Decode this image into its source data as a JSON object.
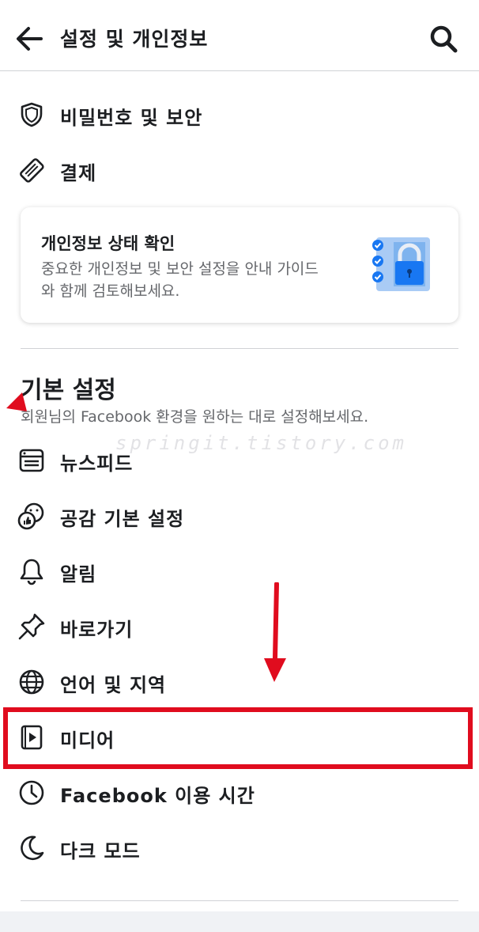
{
  "header": {
    "title": "설정 및 개인정보",
    "back_icon": "arrow-left-icon",
    "search_icon": "search-icon"
  },
  "top_items": [
    {
      "label": "비밀번호 및 보안",
      "icon": "shield-icon"
    },
    {
      "label": "결제",
      "icon": "payment-card-icon"
    }
  ],
  "privacy_card": {
    "title": "개인정보 상태 확인",
    "description": "중요한 개인정보 및 보안 설정을 안내 가이드와 함께 검토해보세요.",
    "art": "privacy-lock-illustration-icon"
  },
  "basic_settings": {
    "title": "기본 설정",
    "subtitle": "회원님의 Facebook 환경을 원하는 대로 설정해보세요.",
    "items": [
      {
        "label": "뉴스피드",
        "icon": "news-feed-icon"
      },
      {
        "label": "공감 기본 설정",
        "icon": "reactions-icon"
      },
      {
        "label": "알림",
        "icon": "bell-icon"
      },
      {
        "label": "바로가기",
        "icon": "pin-icon"
      },
      {
        "label": "언어 및 지역",
        "icon": "globe-icon"
      },
      {
        "label": "미디어",
        "icon": "media-icon"
      },
      {
        "label": "Facebook 이용 시간",
        "icon": "clock-icon"
      },
      {
        "label": "다크 모드",
        "icon": "moon-icon"
      }
    ]
  },
  "watermark": "springit.tistory.com",
  "colors": {
    "annotation_red": "#e00c1e",
    "accent_blue": "#1877f2",
    "text_primary": "#1c1e21",
    "text_secondary": "#65676b"
  }
}
